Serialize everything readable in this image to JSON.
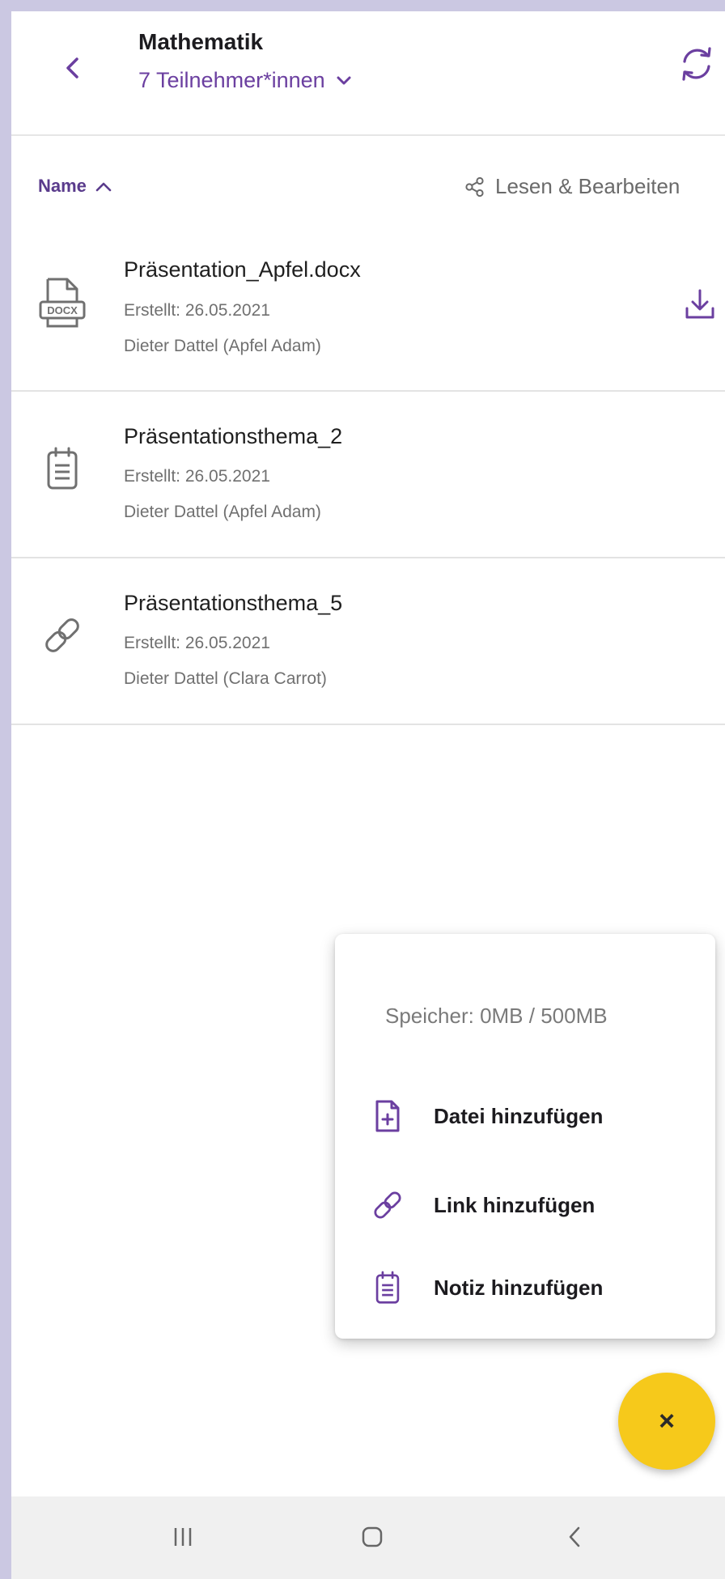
{
  "header": {
    "title": "Mathematik",
    "participants": "7 Teilnehmer*innen",
    "accent_color": "#6b3fa0"
  },
  "sort_bar": {
    "sort_label": "Name",
    "sort_direction": "ascending",
    "permission_label": "Lesen & Bearbeiten"
  },
  "files": [
    {
      "name": "Präsentation_Apfel.docx",
      "created": "Erstellt: 26.05.2021",
      "author": "Dieter Dattel (Apfel Adam)",
      "type_icon": "docx-file-icon",
      "downloadable": true
    },
    {
      "name": "Präsentationsthema_2",
      "created": "Erstellt: 26.05.2021",
      "author": "Dieter Dattel (Apfel Adam)",
      "type_icon": "note-icon",
      "downloadable": false
    },
    {
      "name": "Präsentationsthema_5",
      "created": "Erstellt: 26.05.2021",
      "author": "Dieter Dattel (Clara  Carrot)",
      "type_icon": "link-icon",
      "downloadable": false
    }
  ],
  "menu": {
    "storage": "Speicher: 0MB / 500MB",
    "items": [
      {
        "label": "Datei hinzufügen",
        "icon": "file-add-icon"
      },
      {
        "label": "Link hinzufügen",
        "icon": "link-icon"
      },
      {
        "label": "Notiz hinzufügen",
        "icon": "note-icon"
      }
    ]
  },
  "fab": {
    "label": "×",
    "color": "#f6c91b"
  },
  "navbar": {
    "recent_label": "|||",
    "back_label": "<"
  }
}
